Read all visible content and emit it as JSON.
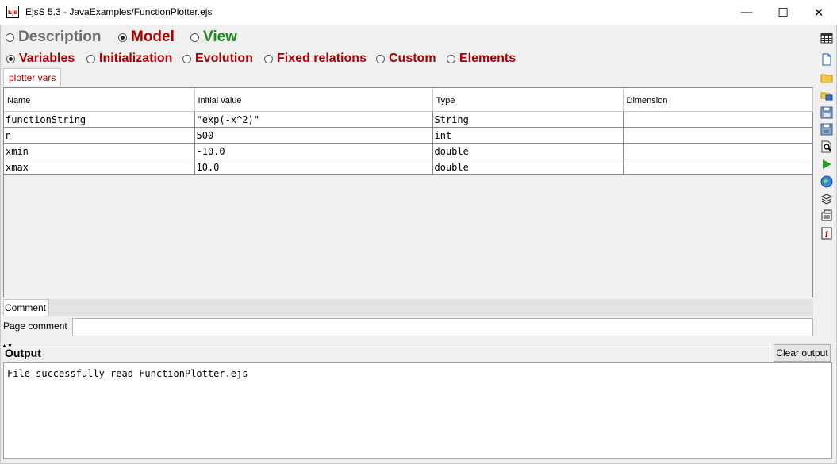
{
  "window": {
    "title": "EjsS 5.3 - JavaExamples/FunctionPlotter.ejs",
    "logo_text": "Ejs",
    "minimize_glyph": "—",
    "maximize_glyph": "☐",
    "close_glyph": "✕"
  },
  "main_tabs": [
    {
      "label": "Description",
      "selected": false,
      "color": "#6b6b6b"
    },
    {
      "label": "Model",
      "selected": true,
      "color": "#a80000"
    },
    {
      "label": "View",
      "selected": false,
      "color": "#1a8a1a"
    }
  ],
  "model_tabs": [
    {
      "label": "Variables",
      "selected": true
    },
    {
      "label": "Initialization",
      "selected": false
    },
    {
      "label": "Evolution",
      "selected": false
    },
    {
      "label": "Fixed relations",
      "selected": false
    },
    {
      "label": "Custom",
      "selected": false
    },
    {
      "label": "Elements",
      "selected": false
    }
  ],
  "variables_page_tab": "plotter vars",
  "table": {
    "headers": [
      "Name",
      "Initial value",
      "Type",
      "Dimension"
    ],
    "rows": [
      [
        "functionString",
        "\"exp(-x^2)\"",
        "String",
        ""
      ],
      [
        "n",
        "500",
        "int",
        ""
      ],
      [
        "xmin",
        "-10.0",
        "double",
        ""
      ],
      [
        "xmax",
        "10.0",
        "double",
        ""
      ]
    ]
  },
  "comment_tab": "Comment",
  "page_comment_label": "Page comment",
  "page_comment_value": "",
  "output": {
    "label": "Output",
    "clear_label": "Clear output",
    "text": "File successfully read FunctionPlotter.ejs"
  },
  "colors": {
    "accent_red": "#a80000",
    "view_green": "#1a8a1a",
    "description_gray": "#6b6b6b"
  },
  "toolbar_icons": [
    "grid-icon",
    "new-file-icon",
    "open-folder-icon",
    "open-remote-icon",
    "save-icon",
    "save-as-icon",
    "search-icon",
    "run-icon",
    "web-globe-icon",
    "package-icon",
    "options-icon",
    "info-icon"
  ]
}
